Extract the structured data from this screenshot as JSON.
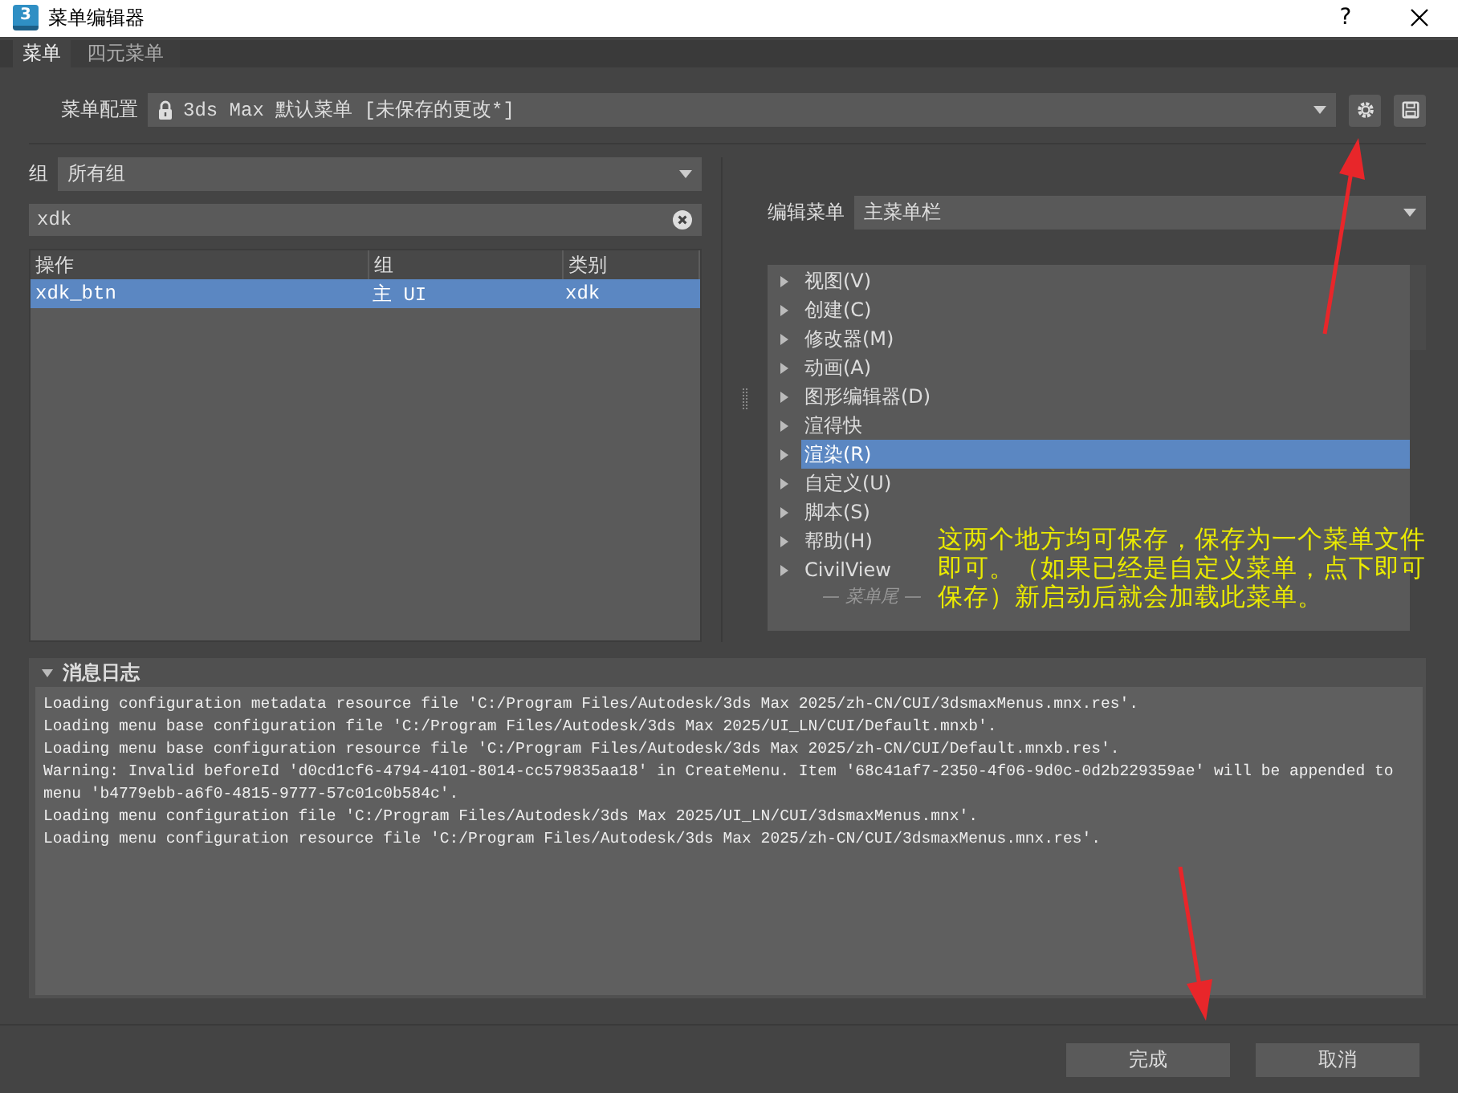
{
  "window": {
    "logo": "3",
    "title": "菜单编辑器",
    "buttons": [
      "?"
    ]
  },
  "tabs": [
    {
      "label": "菜单",
      "selected": true
    },
    {
      "label": "四元菜单",
      "selected": false
    }
  ],
  "config": {
    "label": "菜单配置",
    "value": "3ds Max 默认菜单 [未保存的更改*]",
    "locked": true
  },
  "group_filter": {
    "label": "组",
    "value": "所有组"
  },
  "search": {
    "value": "xdk"
  },
  "table": {
    "columns": [
      "操作",
      "组",
      "类别"
    ],
    "rows": [
      {
        "cells": [
          "xdk_btn",
          "主 UI",
          "xdk"
        ],
        "selected": true
      }
    ]
  },
  "edit_menu": {
    "label": "编辑菜单",
    "value": "主菜单栏"
  },
  "menu_tree": {
    "items": [
      {
        "label": "视图(V)",
        "selected": false
      },
      {
        "label": "创建(C)",
        "selected": false
      },
      {
        "label": "修改器(M)",
        "selected": false
      },
      {
        "label": "动画(A)",
        "selected": false
      },
      {
        "label": "图形编辑器(D)",
        "selected": false
      },
      {
        "label": "渲得快",
        "selected": false
      },
      {
        "label": "渲染(R)",
        "selected": true
      },
      {
        "label": "自定义(U)",
        "selected": false
      },
      {
        "label": "脚本(S)",
        "selected": false
      },
      {
        "label": "帮助(H)",
        "selected": false
      },
      {
        "label": "CivilView",
        "selected": false
      }
    ],
    "end_marker": "— 菜单尾 —"
  },
  "annotation": "这两个地方均可保存，保存为一个菜单文件即可。（如果已经是自定义菜单，点下即可保存）新启动后就会加载此菜单。",
  "log": {
    "title": "消息日志",
    "expanded": true,
    "lines": [
      "Loading configuration metadata resource file 'C:/Program Files/Autodesk/3ds Max 2025/zh-CN/CUI/3dsmaxMenus.mnx.res'.",
      "Loading menu base configuration file 'C:/Program Files/Autodesk/3ds Max 2025/UI_LN/CUI/Default.mnxb'.",
      "Loading menu base configuration resource file 'C:/Program Files/Autodesk/3ds Max 2025/zh-CN/CUI/Default.mnxb.res'.",
      "Warning: Invalid beforeId 'd0cd1cf6-4794-4101-8014-cc579835aa18' in CreateMenu. Item '68c41af7-2350-4f06-9d0c-0d2b229359ae' will be appended to menu 'b4779ebb-a6f0-4815-9777-57c01c0b584c'.",
      "Loading menu configuration file 'C:/Program Files/Autodesk/3ds Max 2025/UI_LN/CUI/3dsmaxMenus.mnx'.",
      "Loading menu configuration resource file 'C:/Program Files/Autodesk/3ds Max 2025/zh-CN/CUI/3dsmaxMenus.mnx.res'."
    ]
  },
  "footer_buttons": [
    "完成",
    "取消"
  ]
}
